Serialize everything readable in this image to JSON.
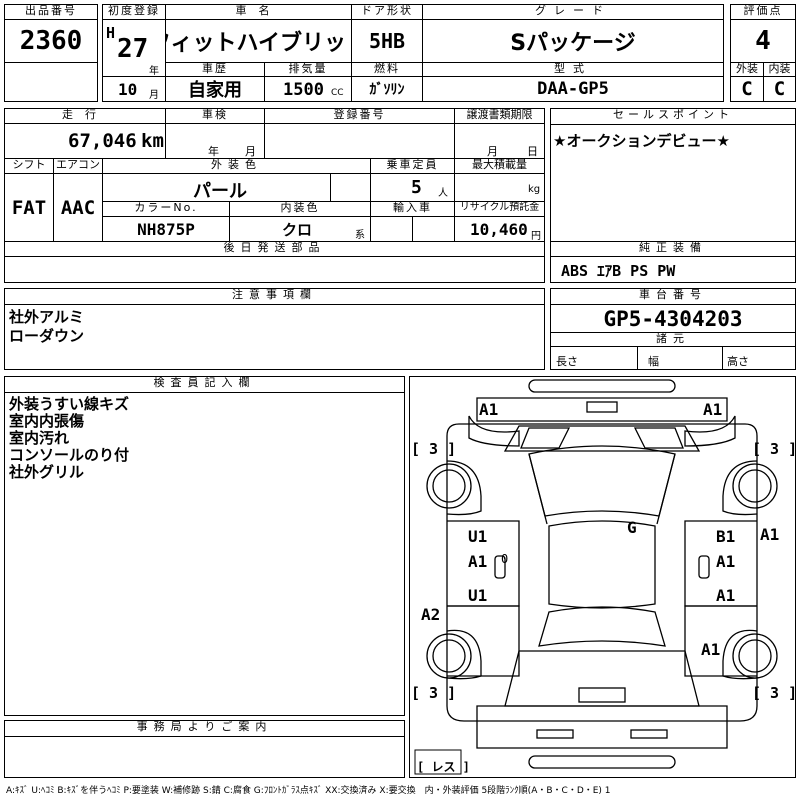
{
  "header": {
    "lot_label": "出品番号",
    "lot_no": "2360",
    "reg_label": "初度登録",
    "era": "H",
    "year": "27",
    "year_unit": "年",
    "month": "10",
    "month_unit": "月",
    "model_label": "車名",
    "model": "フィットハイブリッド",
    "hist_label": "車歴",
    "history": "自家用",
    "disp_label": "排気量",
    "displacement": "1500",
    "disp_unit": "CC",
    "door_label": "ドア形状",
    "door": "5HB",
    "fuel_label": "燃料",
    "fuel": "ｶﾞｿﾘﾝ",
    "grade_label": "グレード",
    "grade": "Sパッケージ",
    "type_label": "型式",
    "type": "DAA-GP5",
    "score_label": "評価点",
    "score": "4",
    "ext_label": "外装",
    "ext": "C",
    "int_label": "内装",
    "int": "C"
  },
  "row2": {
    "mileage_label": "走行",
    "mileage": "67,046",
    "mileage_unit": "km",
    "inspect_label": "車検",
    "year_unit": "年",
    "month_unit": "月",
    "regno_label": "登録番号",
    "transfer_label": "譲渡書類期限",
    "tmonth_unit": "月",
    "tday_unit": "日",
    "shift_label": "シフト",
    "shift": "FAT",
    "ac_label": "エアコン",
    "ac": "AAC",
    "color_label": "外装色",
    "color": "パール",
    "capacity_label": "乗車定員",
    "capacity": "5",
    "capacity_unit": "人",
    "load_label": "最大積載量",
    "load_unit": "kg",
    "colorno_label": "カラーNo.",
    "colorno": "NH875P",
    "intcolor_label": "内装色",
    "intcolor": "クロ",
    "intcolor_unit": "系",
    "import_label": "輸入車",
    "recycle_label": "リサイクル預託金",
    "recycle": "10,460",
    "recycle_unit": "円",
    "later_label": "後日発送部品"
  },
  "sales": {
    "label": "セールスポイント",
    "text": "★オークションデビュー★"
  },
  "equipment": {
    "label": "純正装備",
    "text": "ABS ｴｱB PS PW"
  },
  "caution": {
    "label": "注意事項欄",
    "lines": [
      "社外アルミ",
      "ローダウン"
    ]
  },
  "chassis": {
    "label": "車台番号",
    "number": "GP5-4304203",
    "spec_label": "諸元",
    "len_label": "長さ",
    "width_label": "幅",
    "height_label": "高さ"
  },
  "inspector": {
    "label": "検査員記入欄",
    "lines": [
      "外装うすい線キズ",
      "室内内張傷",
      "室内汚れ",
      "コンソールのり付",
      "社外グリル"
    ]
  },
  "diagram": {
    "marks": {
      "front_left": "A1",
      "front_right": "A1",
      "tire_fl": "[ 3 ]",
      "tire_fr": "[ 3 ]",
      "tire_rl": "[ 3 ]",
      "tire_rr": "[ 3 ]",
      "spare": "[ レス ]",
      "glass": "G",
      "door_fl_top": "U1",
      "door_fl_bot": "A1",
      "door_rl": "U1",
      "door_fr_top": "B1",
      "door_fr_bot": "A1",
      "door_rr": "A1",
      "right_side": "A1",
      "left_rear": "A2",
      "rear_right": "A1",
      "tiny0": "0"
    }
  },
  "office": {
    "label": "事務局よりご案内"
  },
  "legend": "A:ｷｽﾞ U:ﾍｺﾐ B:ｷｽﾞを伴うﾍｺﾐ P:要塗装 W:補修跡 S:錆 C:腐食 G:ﾌﾛﾝﾄｶﾞﾗｽ点ｷｽﾞ XX:交換済み X:要交換　内・外装評価 5段階ﾗﾝｸ順(A・B・C・D・E) 1"
}
